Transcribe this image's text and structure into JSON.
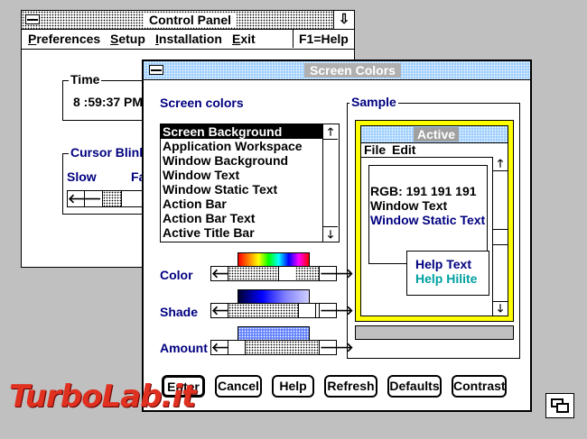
{
  "control_panel": {
    "title": "Control Panel",
    "menu": [
      {
        "accel": "P",
        "rest": "references"
      },
      {
        "accel": "S",
        "rest": "etup"
      },
      {
        "accel": "I",
        "rest": "nstallation"
      },
      {
        "accel": "E",
        "rest": "xit"
      }
    ],
    "help_hint": "F1=Help",
    "time_label": "Time",
    "time_value": "8 :59:37 PM",
    "cursor_blink_label": "Cursor Blink",
    "slow_label": "Slow",
    "fast_label": "Fa"
  },
  "screen_colors": {
    "title": "Screen Colors",
    "screen_colors_label": "Screen colors",
    "list_items": [
      "Screen Background",
      "Application Workspace",
      "Window Background",
      "Window Text",
      "Window Static Text",
      "Action Bar",
      "Action Bar Text",
      "Active Title Bar"
    ],
    "selected_index": 0,
    "color_label": "Color",
    "shade_label": "Shade",
    "amount_label": "Amount",
    "sample_label": "Sample",
    "sample": {
      "title": "Active",
      "menu": [
        "File",
        "Edit"
      ],
      "rgb_text": "RGB: 191 191 191",
      "window_text": "Window Text",
      "static_text": "Window Static Text",
      "help_text": "Help Text",
      "help_hilite": "Help Hilite"
    },
    "buttons": [
      "Enter",
      "Cancel",
      "Help",
      "Refresh",
      "Defaults",
      "Contrast"
    ]
  },
  "colors": {
    "static_blue": "#000080",
    "hilite_teal": "#00a0a0",
    "active_border": "#ffff00",
    "title_blue": "#9fcfff"
  },
  "watermark": "TurboLab.it"
}
